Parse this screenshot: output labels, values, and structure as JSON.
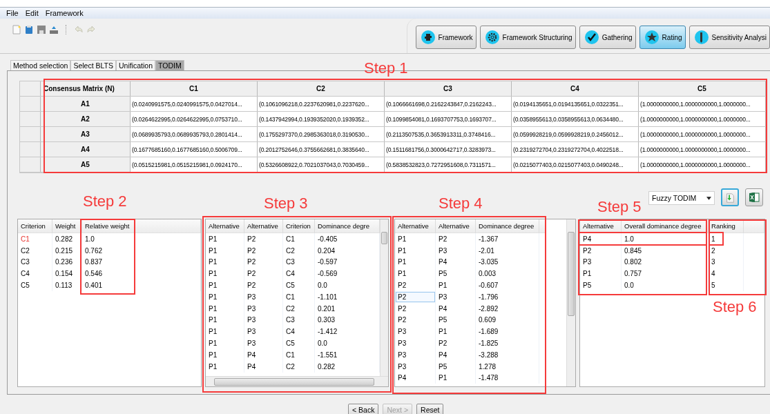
{
  "menu": [
    {
      "label": "File"
    },
    {
      "label": "Edit"
    },
    {
      "label": "Framework"
    }
  ],
  "nav_buttons": [
    {
      "label": "Framework",
      "kind": "puzzle",
      "selected": false
    },
    {
      "label": "Framework Structuring",
      "kind": "gear",
      "selected": false
    },
    {
      "label": "Gathering",
      "kind": "check",
      "selected": false
    },
    {
      "label": "Rating",
      "kind": "star",
      "selected": true
    },
    {
      "label": "Sensitivity Analysi",
      "kind": "pen",
      "selected": false
    }
  ],
  "tabs": [
    {
      "label": "Method selection",
      "selected": false
    },
    {
      "label": "Select BLTS",
      "selected": false
    },
    {
      "label": "Unification",
      "selected": false
    },
    {
      "label": "TODIM",
      "selected": true
    }
  ],
  "matrix": {
    "corner": "Consensus Matrix (N)",
    "columns": [
      "C1",
      "C2",
      "C3",
      "C4",
      "C5"
    ],
    "rows": [
      {
        "label": "A1",
        "cells": [
          "(0.0240991575,0.0240991575,0.0427014...",
          "(0.1061096218,0.2237620981,0.2237620...",
          "(0.1066661698,0.2162243847,0.2162243...",
          "(0.0194135651,0.0194135651,0.0322351...",
          "(1.0000000000,1.0000000000,1.0000000..."
        ]
      },
      {
        "label": "A2",
        "cells": [
          "(0.0264622995,0.0264622995,0.0753710...",
          "(0.1437942994,0.1939352020,0.1939352...",
          "(0.1099854081,0.1693707753,0.1693707...",
          "(0.0358955613,0.0358955613,0.0634480...",
          "(1.0000000000,1.0000000000,1.0000000..."
        ]
      },
      {
        "label": "A3",
        "cells": [
          "(0.0689935793,0.0689935793,0.2801414...",
          "(0.1755297370,0.2985363018,0.3190530...",
          "(0.2113507535,0.3653913311,0.3748416...",
          "(0.0599928219,0.0599928219,0.2456012...",
          "(1.0000000000,1.0000000000,1.0000000..."
        ]
      },
      {
        "label": "A4",
        "cells": [
          "(0.1677685160,0.1677685160,0.5006709...",
          "(0.2012752646,0.3755662681,0.3835640...",
          "(0.1511681756,0.3000642717,0.3283973...",
          "(0.2319272704,0.2319272704,0.4022518...",
          "(1.0000000000,1.0000000000,1.0000000..."
        ]
      },
      {
        "label": "A5",
        "cells": [
          "(0.0515215981,0.0515215981,0.0924170...",
          "(0.5326608922,0.7021037043,0.7030459...",
          "(0.5838532823,0.7272951608,0.7311571...",
          "(0.0215077403,0.0215077403,0.0490248...",
          "(1.0000000000,1.0000000000,1.0000000..."
        ]
      }
    ]
  },
  "method_select": {
    "value": "Fuzzy TODIM"
  },
  "weights": {
    "columns": [
      "Criterion",
      "Weight",
      "Relative weight"
    ],
    "rows": [
      {
        "cells": [
          "C1",
          "0.282",
          "1.0"
        ],
        "highlighted": true
      },
      {
        "cells": [
          "C2",
          "0.215",
          "0.762"
        ],
        "highlighted": false
      },
      {
        "cells": [
          "C3",
          "0.236",
          "0.837"
        ],
        "highlighted": false
      },
      {
        "cells": [
          "C4",
          "0.154",
          "0.546"
        ],
        "highlighted": false
      },
      {
        "cells": [
          "C5",
          "0.113",
          "0.401"
        ],
        "highlighted": false
      }
    ]
  },
  "dominance_by_criterion": {
    "columns": [
      "Alternative",
      "Alternative",
      "Criterion",
      "Dominance degre"
    ],
    "rows": [
      {
        "cells": [
          "P1",
          "P2",
          "C1",
          "-0.405"
        ]
      },
      {
        "cells": [
          "P1",
          "P2",
          "C2",
          "0.204"
        ]
      },
      {
        "cells": [
          "P1",
          "P2",
          "C3",
          "-0.597"
        ]
      },
      {
        "cells": [
          "P1",
          "P2",
          "C4",
          "-0.569"
        ]
      },
      {
        "cells": [
          "P1",
          "P2",
          "C5",
          "0.0"
        ]
      },
      {
        "cells": [
          "P1",
          "P3",
          "C1",
          "-1.101"
        ]
      },
      {
        "cells": [
          "P1",
          "P3",
          "C2",
          "0.201"
        ]
      },
      {
        "cells": [
          "P1",
          "P3",
          "C3",
          "0.303"
        ]
      },
      {
        "cells": [
          "P1",
          "P3",
          "C4",
          "-1.412"
        ]
      },
      {
        "cells": [
          "P1",
          "P3",
          "C5",
          "0.0"
        ]
      },
      {
        "cells": [
          "P1",
          "P4",
          "C1",
          "-1.551"
        ]
      },
      {
        "cells": [
          "P1",
          "P4",
          "C2",
          "0.282"
        ]
      }
    ]
  },
  "dominance": {
    "columns": [
      "Alternative",
      "Alternative",
      "Dominance degree"
    ],
    "rows": [
      {
        "cells": [
          "P1",
          "P2",
          "-1.367"
        ],
        "focused": false
      },
      {
        "cells": [
          "P1",
          "P3",
          "-2.01"
        ],
        "focused": false
      },
      {
        "cells": [
          "P1",
          "P4",
          "-3.035"
        ],
        "focused": false
      },
      {
        "cells": [
          "P1",
          "P5",
          "0.003"
        ],
        "focused": false
      },
      {
        "cells": [
          "P2",
          "P1",
          "-0.607"
        ],
        "focused": false
      },
      {
        "cells": [
          "P2",
          "P3",
          "-1.796"
        ],
        "focused": true
      },
      {
        "cells": [
          "P2",
          "P4",
          "-2.892"
        ],
        "focused": false
      },
      {
        "cells": [
          "P2",
          "P5",
          "0.609"
        ],
        "focused": false
      },
      {
        "cells": [
          "P3",
          "P1",
          "-1.689"
        ],
        "focused": false
      },
      {
        "cells": [
          "P3",
          "P2",
          "-1.825"
        ],
        "focused": false
      },
      {
        "cells": [
          "P3",
          "P4",
          "-3.288"
        ],
        "focused": false
      },
      {
        "cells": [
          "P3",
          "P5",
          "1.278"
        ],
        "focused": false
      },
      {
        "cells": [
          "P4",
          "P1",
          "-1.478"
        ],
        "focused": false
      }
    ]
  },
  "overall": {
    "columns": [
      "Alternative",
      "Overall dominance degree",
      "Ranking"
    ],
    "rows": [
      {
        "cells": [
          "P4",
          "1.0",
          "1"
        ]
      },
      {
        "cells": [
          "P2",
          "0.845",
          "2"
        ]
      },
      {
        "cells": [
          "P3",
          "0.802",
          "3"
        ]
      },
      {
        "cells": [
          "P1",
          "0.757",
          "4"
        ]
      },
      {
        "cells": [
          "P5",
          "0.0",
          "5"
        ]
      }
    ]
  },
  "annotations": [
    "Step 1",
    "Step 2",
    "Step 3",
    "Step 4",
    "Step 5",
    "Step 6"
  ],
  "buttons": [
    {
      "label": "< Back",
      "disabled": false
    },
    {
      "label": "Next >",
      "disabled": true
    },
    {
      "label": "Reset",
      "disabled": false
    }
  ]
}
